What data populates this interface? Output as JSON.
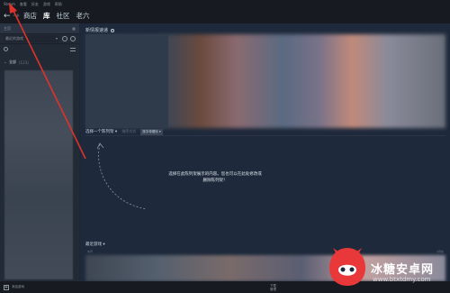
{
  "menubar": {
    "items": [
      "Steam",
      "查看",
      "好友",
      "游戏",
      "帮助"
    ]
  },
  "navbar": {
    "items": [
      "商店",
      "库",
      "社区",
      "老六"
    ],
    "active_index": 1
  },
  "sidebar": {
    "home": "主页",
    "filter_select": "最近的游戏",
    "group": "全部",
    "group_count": "(123)"
  },
  "main": {
    "whats_new": "新情报速递",
    "shelf_note": "已隐藏收藏列表",
    "collection_select": "选择一个陈列架",
    "sort_label": "排序方式",
    "sort_value": "按字母顺序",
    "empty_msg_line1": "选择在此陈列架展示的内容。您也可以在此处修改或",
    "empty_msg_line2": "删除陈列架！",
    "recent_games": "最近游戏",
    "recent_left": "本周",
    "recent_right": "4周前"
  },
  "statusbar": {
    "add_game": "添加游戏",
    "downloads": "下载",
    "downloads_status": "管理"
  },
  "watermark": {
    "title": "冰糖安卓网",
    "url": "www.btxtdmy.com"
  },
  "colors": {
    "accent": "#1b2838",
    "arrow": "#e0322b",
    "nav_bg": "#171a21"
  }
}
